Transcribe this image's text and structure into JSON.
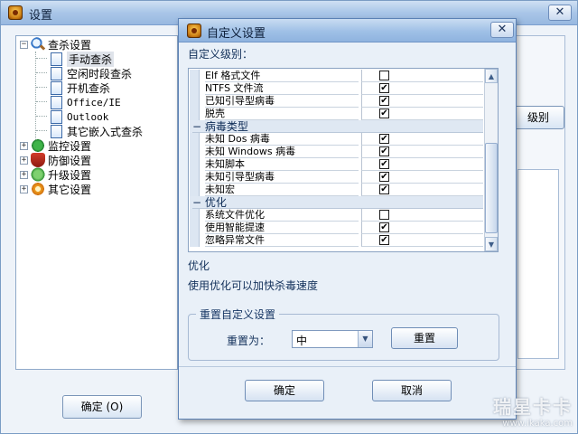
{
  "main_window": {
    "title": "设置",
    "tree": [
      {
        "label": "查杀设置",
        "icon": "search-icon",
        "expanded": true
      },
      {
        "label": "手动查杀",
        "icon": "document-icon",
        "selected": true
      },
      {
        "label": "空闲时段查杀",
        "icon": "document-icon"
      },
      {
        "label": "开机查杀",
        "icon": "document-icon"
      },
      {
        "label": "Office/IE",
        "icon": "document-icon"
      },
      {
        "label": "Outlook",
        "icon": "document-icon"
      },
      {
        "label": "其它嵌入式查杀",
        "icon": "document-icon"
      },
      {
        "label": "监控设置",
        "icon": "umbrella-icon",
        "expanded": false
      },
      {
        "label": "防御设置",
        "icon": "shield-icon",
        "expanded": false
      },
      {
        "label": "升级设置",
        "icon": "update-icon",
        "expanded": false
      },
      {
        "label": "其它设置",
        "icon": "gear-icon",
        "expanded": false
      }
    ],
    "partial_button_label": "级别",
    "ok_label": "确定 (O)"
  },
  "dialog": {
    "title": "自定义设置",
    "level_label": "自定义级别：",
    "rows": [
      {
        "type": "item",
        "name": "Elf 格式文件",
        "checked": false
      },
      {
        "type": "item",
        "name": "NTFS 文件流",
        "checked": true
      },
      {
        "type": "item",
        "name": "已知引导型病毒",
        "checked": true
      },
      {
        "type": "item",
        "name": "脱壳",
        "checked": true
      },
      {
        "type": "category",
        "name": "病毒类型"
      },
      {
        "type": "item",
        "name": "未知 Dos 病毒",
        "checked": true
      },
      {
        "type": "item",
        "name": "未知 Windows 病毒",
        "checked": true
      },
      {
        "type": "item",
        "name": "未知脚本",
        "checked": true
      },
      {
        "type": "item",
        "name": "未知引导型病毒",
        "checked": true
      },
      {
        "type": "item",
        "name": "未知宏",
        "checked": true
      },
      {
        "type": "category",
        "name": "优化"
      },
      {
        "type": "item",
        "name": "系统文件优化",
        "checked": false
      },
      {
        "type": "item",
        "name": "使用智能提速",
        "checked": true
      },
      {
        "type": "item",
        "name": "忽略异常文件",
        "checked": true
      }
    ],
    "collapse_glyph": "−",
    "check_glyph": "✔",
    "desc_title": "优化",
    "desc_text": "使用优化可以加快杀毒速度",
    "reset_group": {
      "title": "重置自定义设置",
      "reset_to_label": "重置为：",
      "selected_value": "中",
      "reset_button": "重置"
    },
    "ok_button": "确定",
    "cancel_button": "取消"
  },
  "watermark": {
    "main": "瑞星卡卡",
    "url": "www.ikaka.com"
  },
  "colors": {
    "title_gradient": "#a9c6e8",
    "accent": "#5b81b5",
    "category_bg": "#dfe8f3"
  }
}
